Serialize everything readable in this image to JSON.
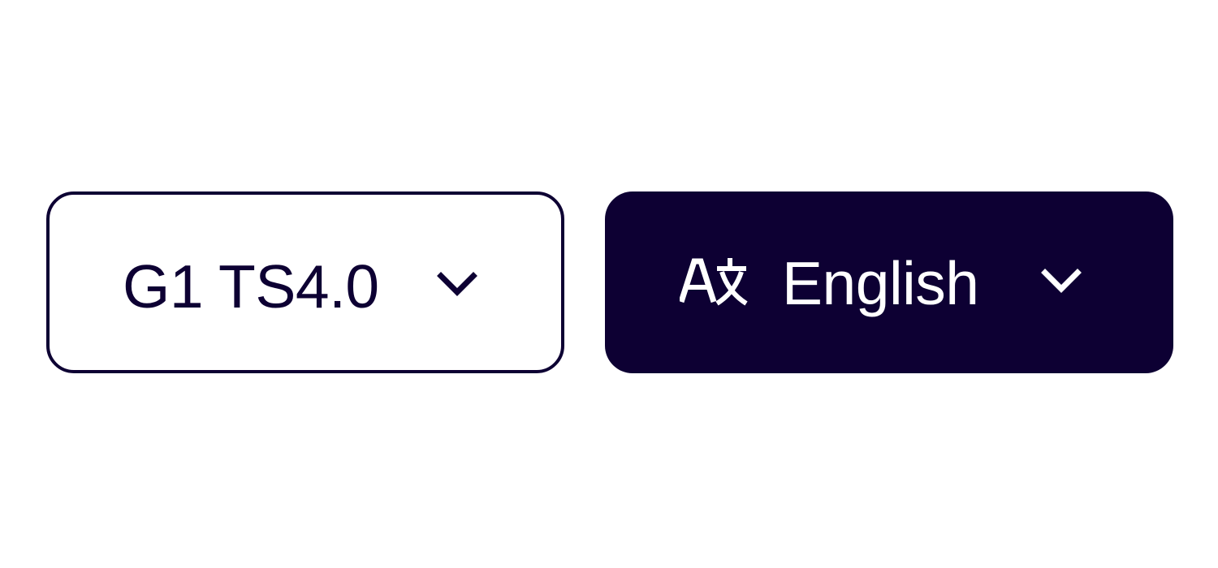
{
  "theme": {
    "primary": "#0d0033",
    "background": "#ffffff"
  },
  "version_selector": {
    "label": "G1 TS4.0",
    "icon": "chevron-down-icon"
  },
  "language_selector": {
    "icon": "translate-icon",
    "label": "English",
    "dropdown_icon": "chevron-down-icon"
  }
}
